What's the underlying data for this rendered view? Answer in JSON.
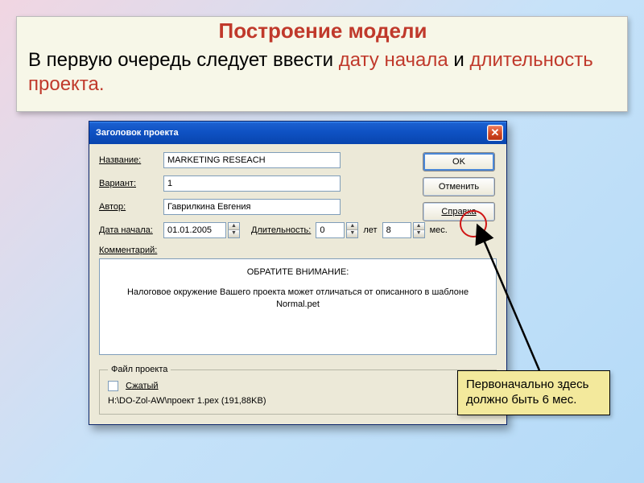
{
  "header": {
    "title": "Построение модели",
    "body_prefix": "В  первую очередь следует ввести ",
    "red1": "дату начала",
    "mid": " и ",
    "red2": "длительность проекта."
  },
  "dialog": {
    "title": "Заголовок проекта",
    "labels": {
      "name": "Название:",
      "variant": "Вариант:",
      "author": "Автор:",
      "date": "Дата начала:",
      "duration": "Длительность:",
      "years": "лет",
      "months": "мес.",
      "comment": "Комментарий:"
    },
    "values": {
      "name": "MARKETING RESEACH",
      "variant": "1",
      "author": "Гаврилкина Евгения",
      "date": "01.01.2005",
      "years": "0",
      "months": "8"
    },
    "buttons": {
      "ok": "OK",
      "cancel": "Отменить",
      "help": "Справка"
    },
    "note_title": "ОБРАТИТЕ ВНИМАНИЕ:",
    "note_body": "Налоговое окружение Вашего проекта может отличаться от описанного в шаблоне Normal.pet",
    "filebox": {
      "legend": "Файл проекта",
      "compressed": "Сжатый",
      "path": "H:\\DO-Zol-AW\\проект 1.pex (191,88KB)"
    }
  },
  "callout": {
    "text": "Первоначально здесь должно быть 6 мес."
  }
}
